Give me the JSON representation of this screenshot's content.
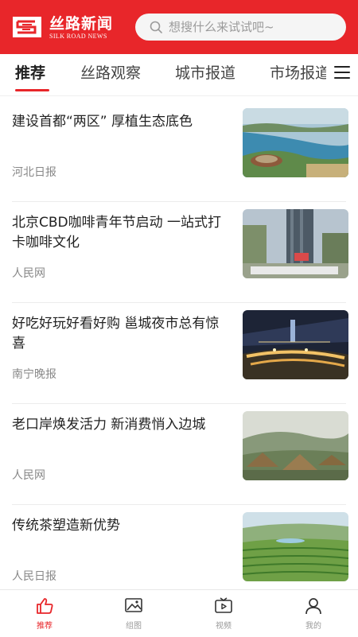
{
  "app": {
    "name": "丝路新闻",
    "name_en": "SILK ROAD NEWS",
    "colors": {
      "brand": "#e8262a",
      "text": "#222222",
      "muted": "#888888"
    }
  },
  "search": {
    "placeholder": "想搜什么来试试吧~",
    "value": ""
  },
  "tabs": [
    {
      "label": "推荐",
      "active": true
    },
    {
      "label": "丝路观察",
      "active": false
    },
    {
      "label": "城市报道",
      "active": false
    },
    {
      "label": "市场报道",
      "active": false
    }
  ],
  "news": [
    {
      "title": "建设首都“两区” 厚植生态底色",
      "source": "河北日报",
      "thumb_icon": "lake-aerial-image"
    },
    {
      "title": "北京CBD咖啡青年节启动 一站式打卡咖啡文化",
      "source": "人民网",
      "thumb_icon": "cbd-tower-image"
    },
    {
      "title": "好吃好玩好看好购 邕城夜市总有惊喜",
      "source": "南宁晚报",
      "thumb_icon": "night-market-image"
    },
    {
      "title": "老口岸焕发活力 新消费悄入边城",
      "source": "人民网",
      "thumb_icon": "thatched-village-image"
    },
    {
      "title": "传统茶塑造新优势",
      "source": "人民日报",
      "thumb_icon": "tea-field-image"
    }
  ],
  "bottom_nav": [
    {
      "label": "推荐",
      "icon": "thumbs-up-icon",
      "active": true
    },
    {
      "label": "组图",
      "icon": "gallery-icon",
      "active": false
    },
    {
      "label": "视频",
      "icon": "video-icon",
      "active": false
    },
    {
      "label": "我的",
      "icon": "user-icon",
      "active": false
    }
  ]
}
